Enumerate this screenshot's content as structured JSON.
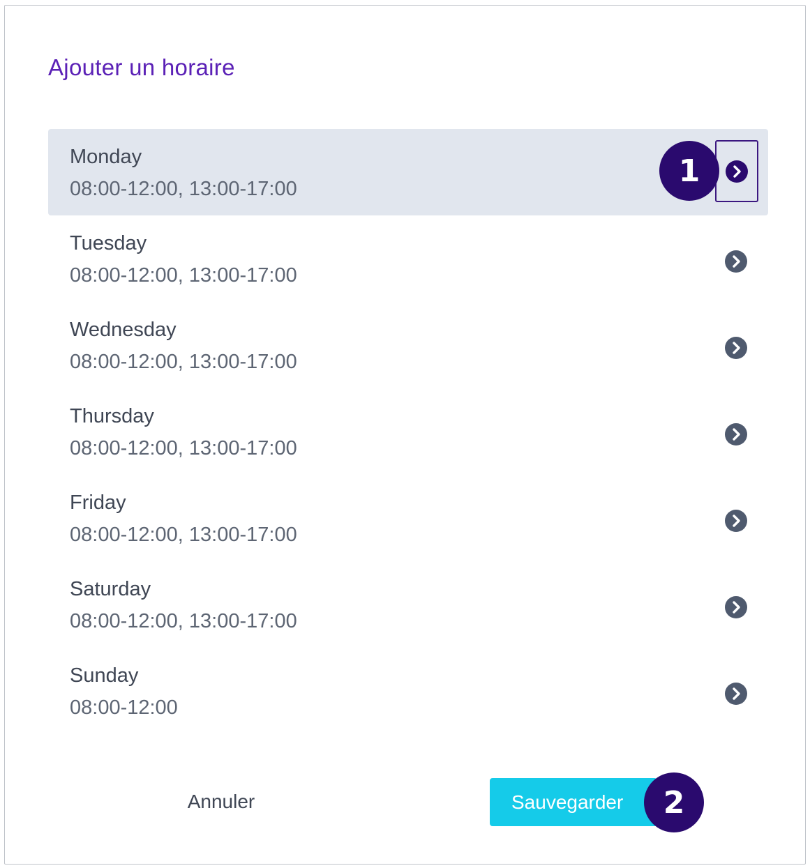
{
  "dialog": {
    "title": "Ajouter un horaire"
  },
  "days": [
    {
      "name": "Monday",
      "hours": "08:00-12:00, 13:00-17:00",
      "selected": true
    },
    {
      "name": "Tuesday",
      "hours": "08:00-12:00, 13:00-17:00",
      "selected": false
    },
    {
      "name": "Wednesday",
      "hours": "08:00-12:00, 13:00-17:00",
      "selected": false
    },
    {
      "name": "Thursday",
      "hours": "08:00-12:00, 13:00-17:00",
      "selected": false
    },
    {
      "name": "Friday",
      "hours": "08:00-12:00, 13:00-17:00",
      "selected": false
    },
    {
      "name": "Saturday",
      "hours": "08:00-12:00, 13:00-17:00",
      "selected": false
    },
    {
      "name": "Sunday",
      "hours": "08:00-12:00",
      "selected": false
    }
  ],
  "footer": {
    "cancel_label": "Annuler",
    "save_label": "Sauvegarder"
  },
  "annotations": {
    "step1": "1",
    "step2": "2"
  },
  "icons": {
    "row_action": "chevron-right-circle-icon"
  },
  "colors": {
    "title": "#5b21b6",
    "selected_row_bg": "#e1e6ee",
    "chevron_default": "#4f5a6e",
    "chevron_selected": "#2a0a6e",
    "badge": "#2a0a6e",
    "save_button": "#15cbe9"
  }
}
